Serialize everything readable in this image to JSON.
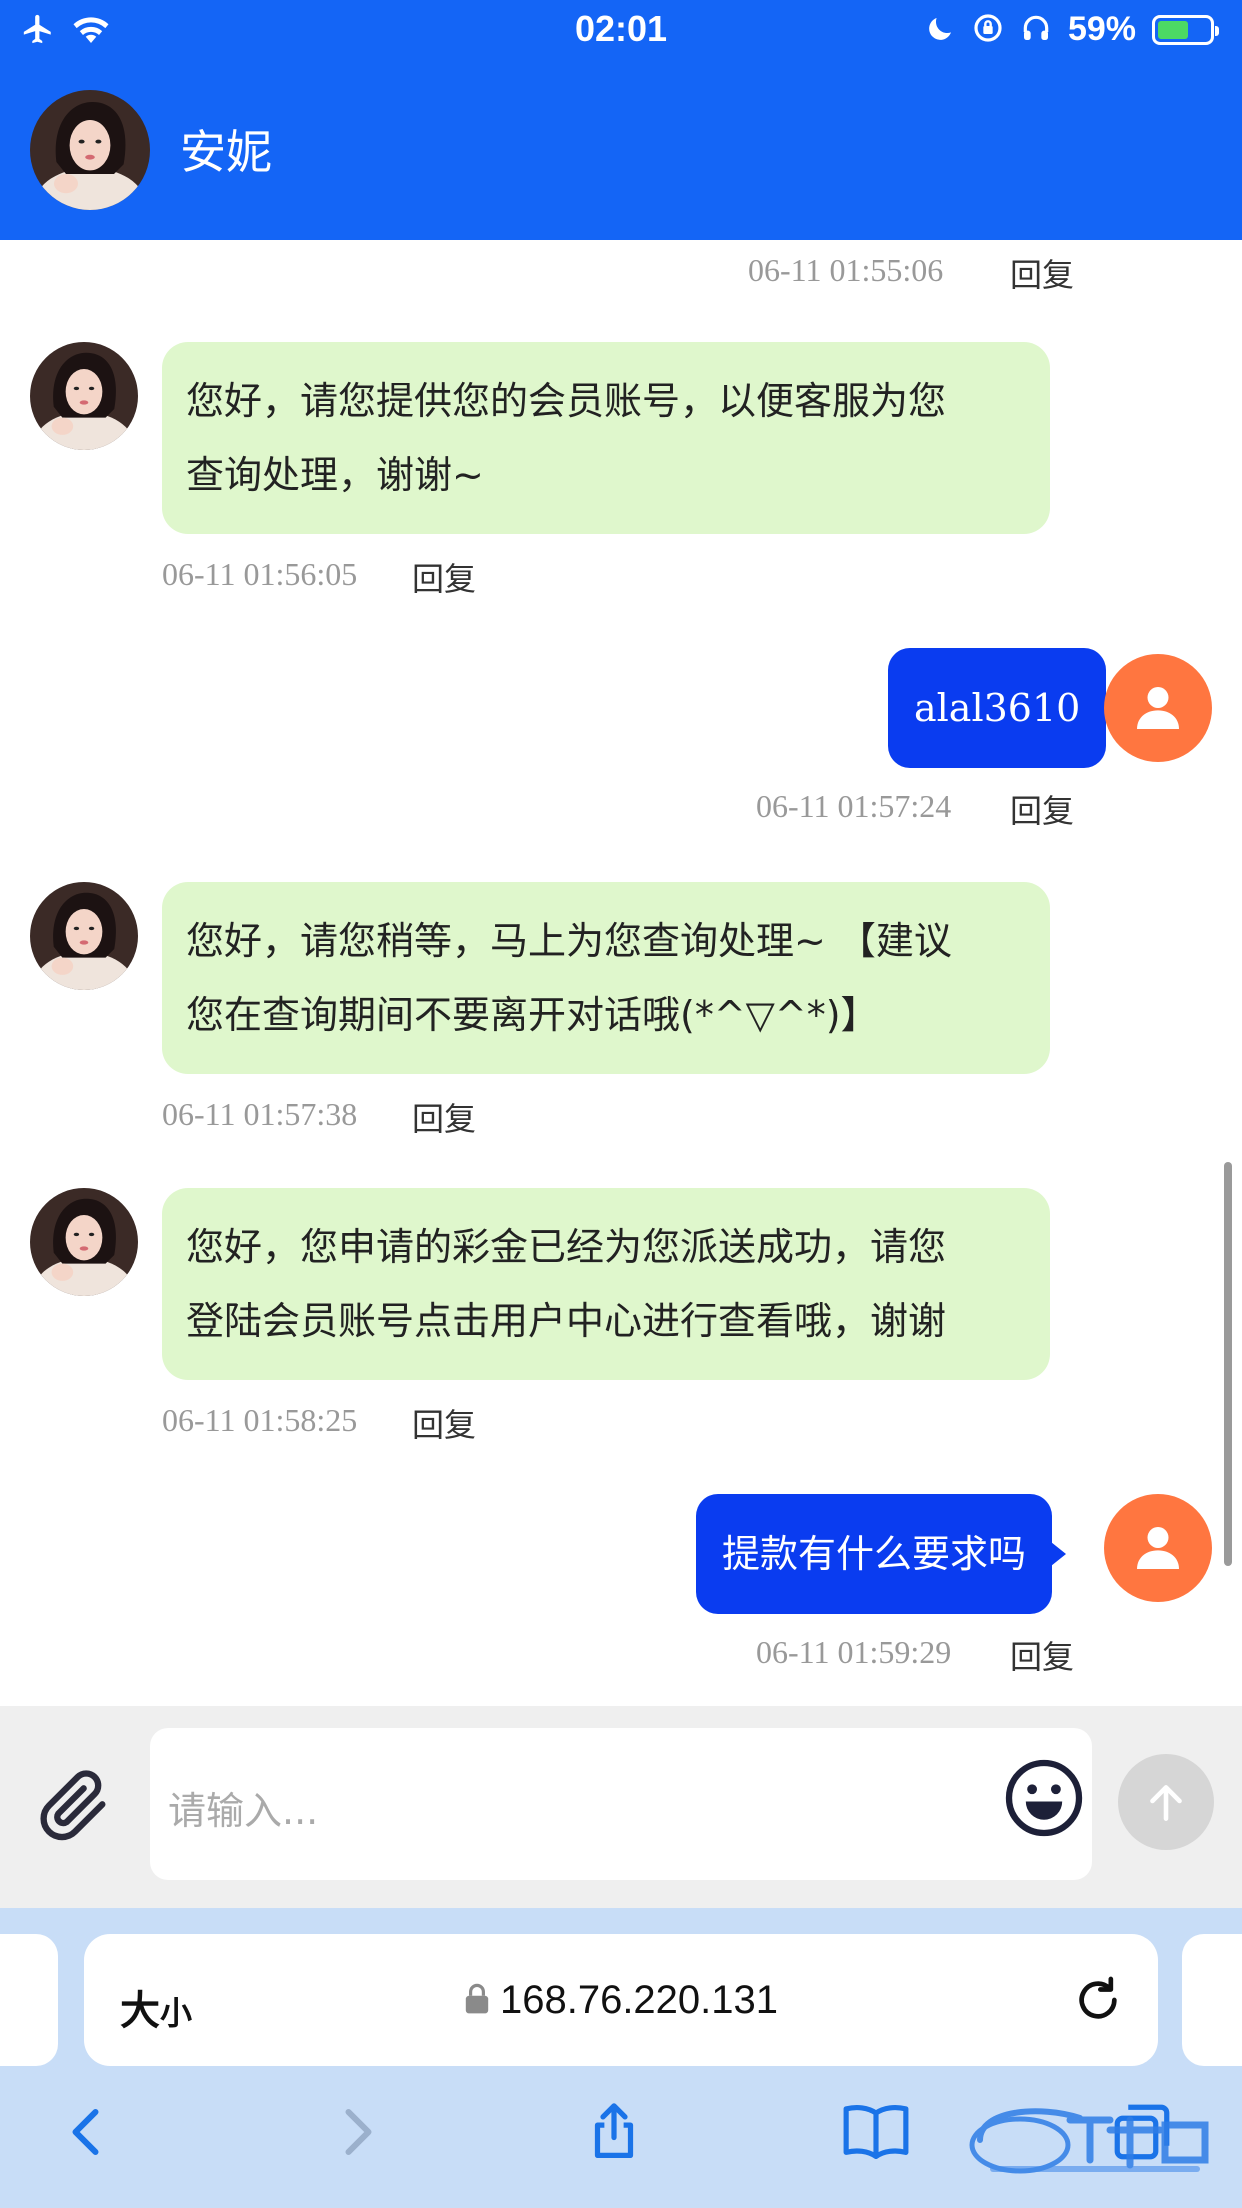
{
  "status_bar": {
    "time": "02:01",
    "battery_percent": "59%",
    "battery_level": 0.59,
    "icons": [
      "airplane-icon",
      "wifi-icon",
      "moon-icon",
      "orientation-lock-icon",
      "headphones-icon",
      "battery-icon"
    ]
  },
  "header": {
    "contact_name": "安妮",
    "avatar_icon": "agent-avatar"
  },
  "messages": [
    {
      "type": "meta-only",
      "time": "06-11 01:55:06",
      "reply_label": "回复"
    },
    {
      "type": "incoming",
      "lines": [
        "您好，请您提供您的会员账号，以便客服为您",
        "查询处理，谢谢~"
      ],
      "time": "06-11 01:56:05",
      "reply_label": "回复"
    },
    {
      "type": "outgoing",
      "text": "alal3610",
      "time": "06-11 01:57:24",
      "reply_label": "回复"
    },
    {
      "type": "incoming",
      "lines": [
        "您好，请您稍等，马上为您查询处理~ 【建议",
        "您在查询期间不要离开对话哦(*^▽^*)】"
      ],
      "time": "06-11 01:57:38",
      "reply_label": "回复"
    },
    {
      "type": "incoming",
      "lines": [
        "您好，您申请的彩金已经为您派送成功，请您",
        "登陆会员账号点击用户中心进行查看哦，谢谢"
      ],
      "time": "06-11 01:58:25",
      "reply_label": "回复"
    },
    {
      "type": "outgoing",
      "text": "提款有什么要求吗",
      "time": "06-11 01:59:29",
      "reply_label": "回复"
    }
  ],
  "composer": {
    "placeholder": "请输入...",
    "attach_icon": "paperclip-icon",
    "emoji_icon": "smiley-icon",
    "send_icon": "arrow-up-icon"
  },
  "browser": {
    "size_label_big": "大",
    "size_label_small": "小",
    "url": "168.76.220.131",
    "reload_icon": "reload-icon",
    "toolbar": [
      "back-icon",
      "forward-icon",
      "share-icon",
      "bookmarks-icon",
      "tabs-icon"
    ]
  },
  "colors": {
    "header_blue": "#1465f6",
    "incoming_bubble": "#dff7cc",
    "outgoing_bubble": "#0a3cf0",
    "user_avatar": "#ff7640",
    "safari_bar": "#c8ddf7"
  }
}
